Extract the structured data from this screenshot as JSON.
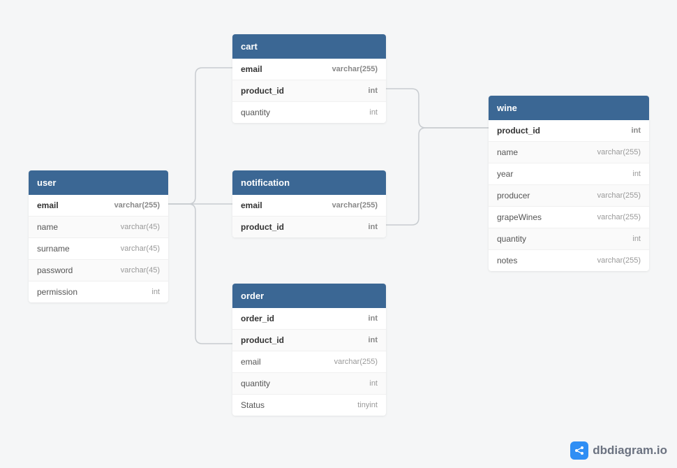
{
  "tables": {
    "user": {
      "title": "user",
      "fields": [
        {
          "name": "email",
          "type": "varchar(255)",
          "pk": true
        },
        {
          "name": "name",
          "type": "varchar(45)",
          "pk": false
        },
        {
          "name": "surname",
          "type": "varchar(45)",
          "pk": false
        },
        {
          "name": "password",
          "type": "varchar(45)",
          "pk": false
        },
        {
          "name": "permission",
          "type": "int",
          "pk": false
        }
      ]
    },
    "cart": {
      "title": "cart",
      "fields": [
        {
          "name": "email",
          "type": "varchar(255)",
          "pk": true
        },
        {
          "name": "product_id",
          "type": "int",
          "pk": true
        },
        {
          "name": "quantity",
          "type": "int",
          "pk": false
        }
      ]
    },
    "notification": {
      "title": "notification",
      "fields": [
        {
          "name": "email",
          "type": "varchar(255)",
          "pk": true
        },
        {
          "name": "product_id",
          "type": "int",
          "pk": true
        }
      ]
    },
    "order": {
      "title": "order",
      "fields": [
        {
          "name": "order_id",
          "type": "int",
          "pk": true
        },
        {
          "name": "product_id",
          "type": "int",
          "pk": true
        },
        {
          "name": "email",
          "type": "varchar(255)",
          "pk": false
        },
        {
          "name": "quantity",
          "type": "int",
          "pk": false
        },
        {
          "name": "Status",
          "type": "tinyint",
          "pk": false
        }
      ]
    },
    "wine": {
      "title": "wine",
      "fields": [
        {
          "name": "product_id",
          "type": "int",
          "pk": true
        },
        {
          "name": "name",
          "type": "varchar(255)",
          "pk": false
        },
        {
          "name": "year",
          "type": "int",
          "pk": false
        },
        {
          "name": "producer",
          "type": "varchar(255)",
          "pk": false
        },
        {
          "name": "grapeWines",
          "type": "varchar(255)",
          "pk": false
        },
        {
          "name": "quantity",
          "type": "int",
          "pk": false
        },
        {
          "name": "notes",
          "type": "varchar(255)",
          "pk": false
        }
      ]
    }
  },
  "branding": {
    "text": "dbdiagram.io"
  }
}
